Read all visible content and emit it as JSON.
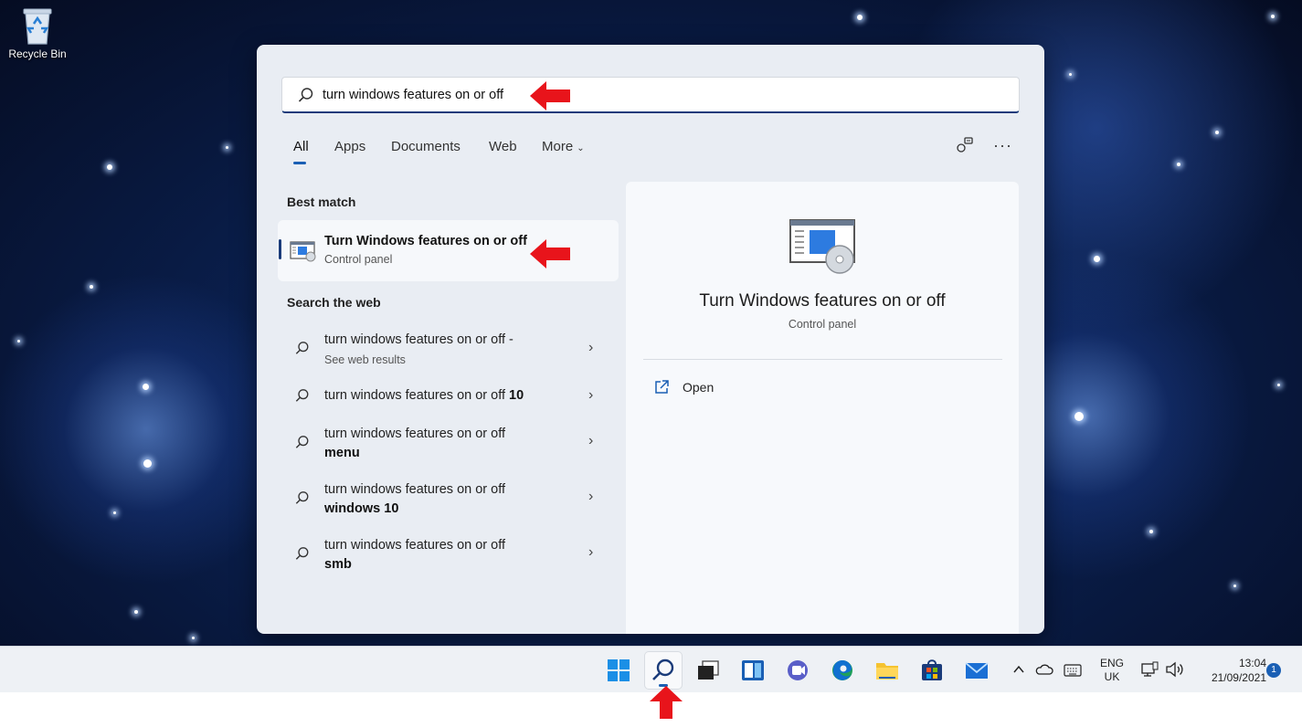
{
  "desktop": {
    "recycle_bin_label": "Recycle Bin"
  },
  "search": {
    "query": "turn windows features on or off",
    "tabs": [
      "All",
      "Apps",
      "Documents",
      "Web",
      "More"
    ],
    "active_tab": "All"
  },
  "best_match": {
    "section_title": "Best match",
    "title": "Turn Windows features on or off",
    "subtitle": "Control panel"
  },
  "web": {
    "section_title": "Search the web",
    "items": [
      {
        "text": "turn windows features on or off -",
        "sub": "See web results"
      },
      {
        "text": "turn windows features on or off",
        "bold": "10"
      },
      {
        "text": "turn windows features on or off",
        "bold": "menu"
      },
      {
        "text": "turn windows features on or off",
        "bold": "windows 10"
      },
      {
        "text": "turn windows features on or off",
        "bold": "smb"
      }
    ]
  },
  "preview": {
    "title": "Turn Windows features on or off",
    "subtitle": "Control panel",
    "open_label": "Open"
  },
  "taskbar": {
    "language_line1": "ENG",
    "language_line2": "UK",
    "time": "13:04",
    "date": "21/09/2021",
    "notification_count": "1"
  },
  "colors": {
    "accent": "#1a5fb4",
    "annotation_arrow": "#e8141b"
  }
}
